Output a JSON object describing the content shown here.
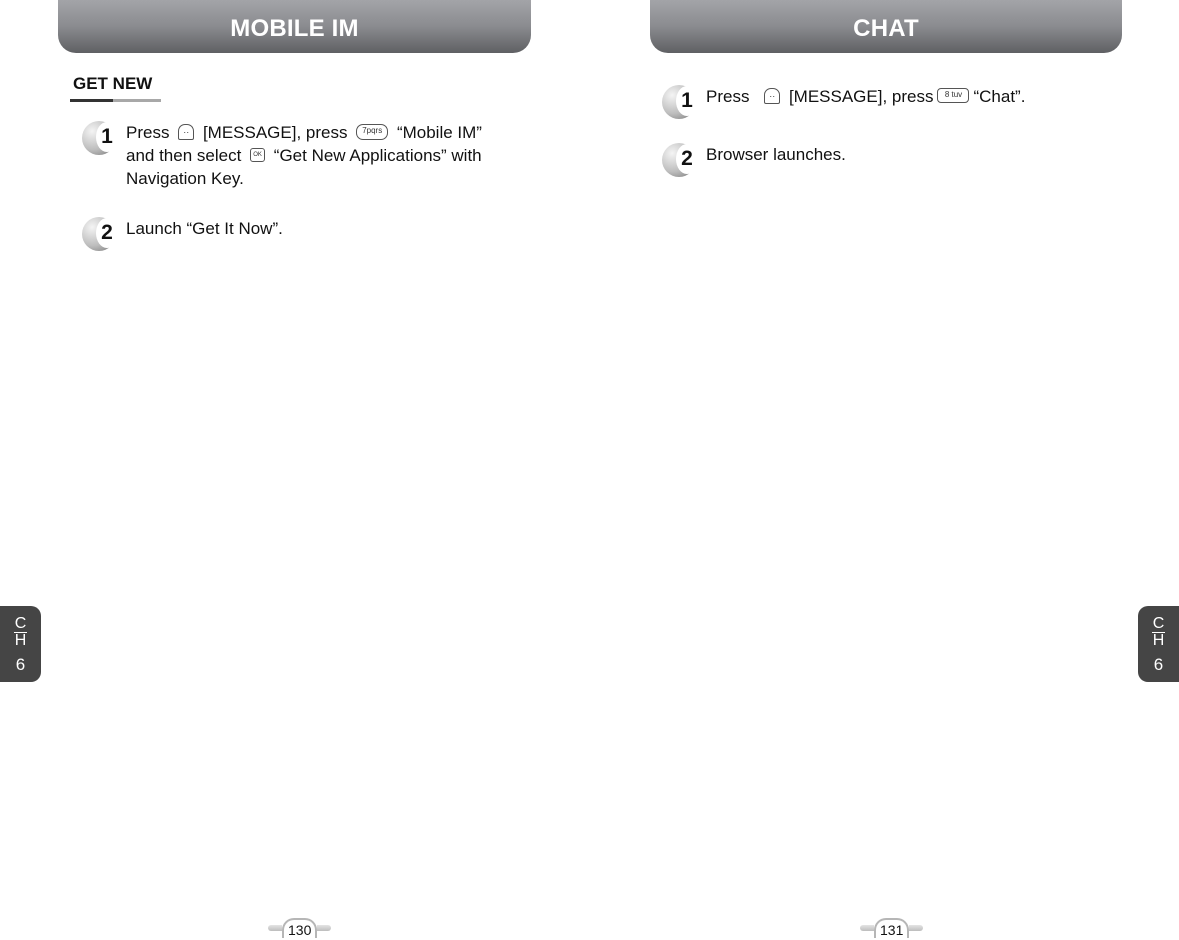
{
  "left_page": {
    "header": "MOBILE IM",
    "section_title": "GET NEW",
    "steps": [
      {
        "number": "1",
        "parts": {
          "a": "Press",
          "b": "[MESSAGE], press",
          "c": "“Mobile IM”",
          "d": "and then select",
          "e": "“Get New Applications” with",
          "f": "Navigation Key."
        },
        "keys": {
          "message": "··",
          "seven": "7pqrs",
          "ok": "OK"
        }
      },
      {
        "number": "2",
        "text": "Launch “Get It Now”."
      }
    ],
    "chapter_tab": {
      "c": "C",
      "h": "H",
      "num": "6"
    },
    "page_number": "130"
  },
  "right_page": {
    "header": "CHAT",
    "steps": [
      {
        "number": "1",
        "parts": {
          "a": "Press",
          "b": "[MESSAGE], press",
          "c": "“Chat”."
        },
        "keys": {
          "message": "··",
          "eight": "8 tuv"
        }
      },
      {
        "number": "2",
        "text": "Browser launches."
      }
    ],
    "chapter_tab": {
      "c": "C",
      "h": "H",
      "num": "6"
    },
    "page_number": "131"
  }
}
